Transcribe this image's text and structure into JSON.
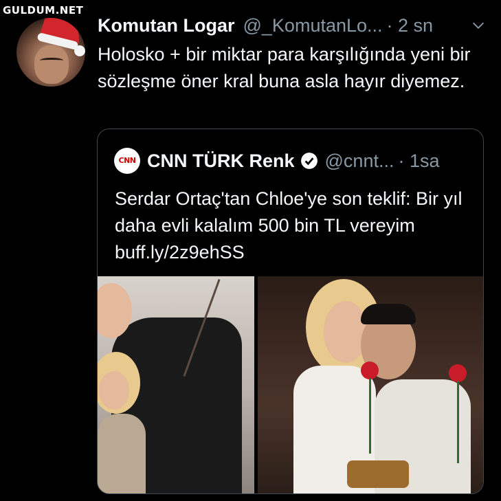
{
  "watermark": "GULDUM.NET",
  "tweet": {
    "display_name": "Komutan Logar",
    "handle": "@_KomutanLo...",
    "time": "· 2 sn",
    "text": "Holosko + bir miktar para karşılığında yeni bir sözleşme öner kral buna asla hayır diyemez."
  },
  "quoted": {
    "display_name": "CNN TÜRK Renk",
    "handle": "@cnnt...",
    "time": "· 1sa",
    "text": "Serdar Ortaç'tan Chloe'ye son teklif: Bir yıl daha evli kalalım 500 bin TL vereyim buff.ly/2z9ehSS",
    "logo_text": "CNN"
  },
  "colors": {
    "background": "#000000",
    "secondary_text": "#8899a6",
    "border": "#3d4a54",
    "brand_red": "#cc0000"
  },
  "icons": [
    "chevron-down-icon",
    "verified-badge-icon"
  ]
}
